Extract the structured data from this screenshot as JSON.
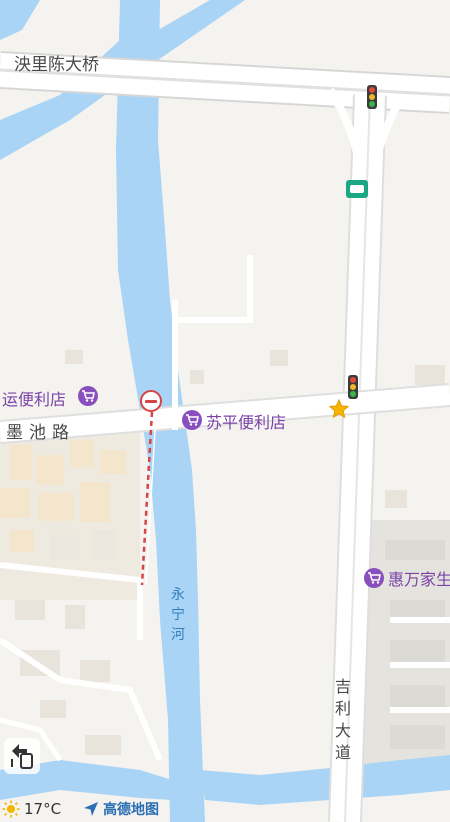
{
  "roads": {
    "bridge": "泱里陈大桥",
    "mochi_road": "墨池路",
    "jili_avenue": "吉利大道"
  },
  "river": {
    "name": "永宁河"
  },
  "pois": {
    "suping": "苏平便利店",
    "yun": "运便利店",
    "huiwan": "惠万家生"
  },
  "status_bar": {
    "temperature": "17°C",
    "app_brand": "高德地图"
  },
  "colors": {
    "water": "#a9d4f5",
    "land": "#f4f3ef",
    "road": "#ffffff",
    "poi_purple": "#8a4fbe",
    "star": "#f5b500",
    "brand_blue": "#2a6fb5"
  },
  "icons": [
    "traffic-light-icon",
    "bus-stop-icon",
    "no-entry-icon",
    "shopping-cart-icon",
    "star-icon",
    "sun-icon",
    "navigation-arrow-icon",
    "route-switch-icon"
  ]
}
